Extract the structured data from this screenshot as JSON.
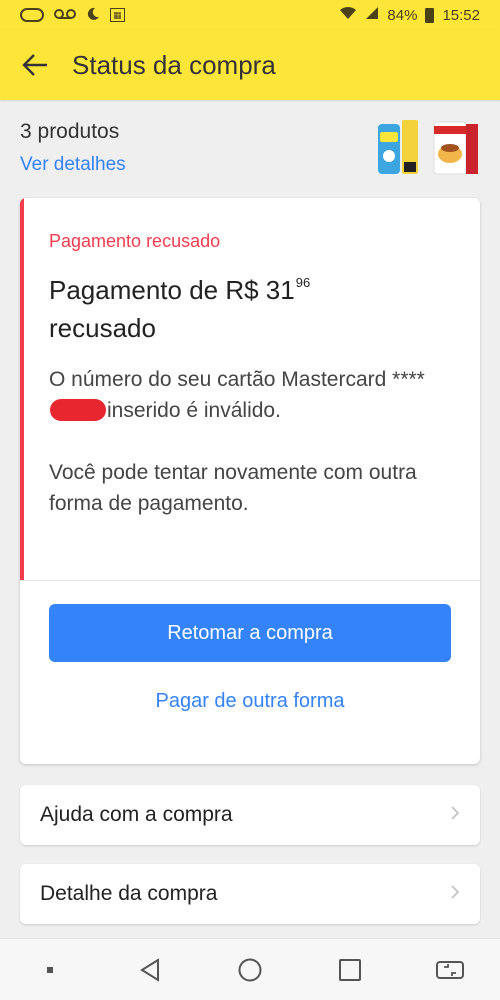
{
  "status_bar": {
    "battery": "84%",
    "time": "15:52",
    "icons": [
      "voicemail-icon",
      "moon-icon",
      "gallery-icon",
      "wifi-icon",
      "signal-icon",
      "battery-icon"
    ]
  },
  "app_bar": {
    "title": "Status da compra",
    "background": "#fde53a",
    "back_icon": "arrow-left-icon"
  },
  "summary": {
    "count_label": "3 produtos",
    "details_link": "Ver detalhes",
    "thumbnails": [
      "ninho-product-thumb",
      "pudding-product-thumb"
    ]
  },
  "payment_card": {
    "status_label": "Pagamento recusado",
    "heading_prefix": "Pagamento de R$ 31",
    "heading_cents": "96",
    "heading_suffix": "recusado",
    "body_line1_prefix": "O número do seu cartão Mastercard ****",
    "body_line1_suffix": "inserido é inválido.",
    "body_line2": "Você pode tentar novamente com outra forma de pagamento.",
    "primary_button": "Retomar a compra",
    "secondary_link": "Pagar de outra forma",
    "accent_color": "#f23d4f",
    "primary_color": "#3483fa"
  },
  "menu": {
    "items": [
      {
        "label": "Ajuda com a compra"
      },
      {
        "label": "Detalhe da compra"
      }
    ]
  },
  "nav_bar": {
    "icons": [
      "dot-icon",
      "back-triangle-icon",
      "home-circle-icon",
      "recents-square-icon",
      "screen-rotate-icon"
    ]
  }
}
